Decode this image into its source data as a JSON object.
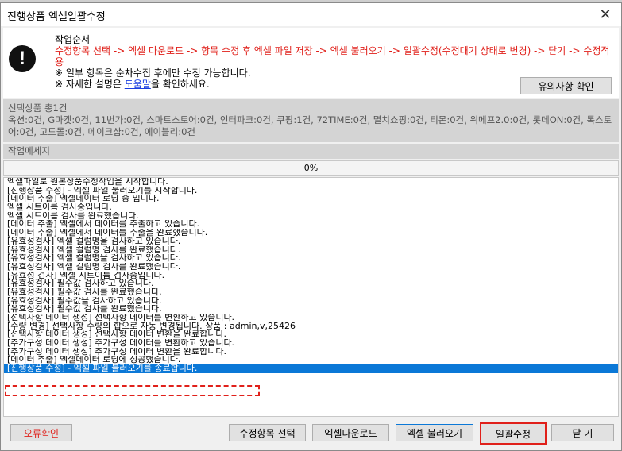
{
  "window": {
    "title": "진행상품 엑셀일괄수정",
    "close_label": "✕"
  },
  "instructions": {
    "heading": "작업순서",
    "steps": "수정항목 선택 -> 엑셀 다운로드 -> 항목 수정 후 엑셀 파일 저장 -> 엑셀 불러오기 -> 일괄수정(수정대기 상태로 변경) -> 닫기 -> 수정적용",
    "note1": "※ 일부 항목은 순차수집 후에만 수정 가능합니다.",
    "note2_prefix": "※ 자세한 설명은 ",
    "note2_link": "도움말",
    "note2_suffix": "을 확인하세요.",
    "caution_button": "유의사항 확인"
  },
  "summary": {
    "title": "선택상품 총1건",
    "detail": "옥션:0건, G마켓:0건, 11번가:0건, 스마트스토어:0건, 인터파크:0건, 쿠팡:1건, 72TIME:0건, 멸치쇼핑:0건, 티몬:0건, 위메프2.0:0건, 롯데ON:0건, 톡스토어:0건, 고도몰:0건, 메이크샵:0건, 에이블리:0건"
  },
  "messages": {
    "header": "작업메세지",
    "progress_text": "0%",
    "progress_value": 0,
    "lines": [
      "엑셀파일로 원본상품수정작업을 시작합니다.",
      "[진행상품 수정] - 엑셀 파일 불러오기를 시작합니다.",
      "[데이터 추출] 엑셀데이터 로딩 중 입니다.",
      "엑셀 시트이름 검사중입니다.",
      "엑셀 시트이름 검사를 완료했습니다.",
      "[데이터 추출] 엑셀에서 데이터를 추출하고 있습니다.",
      "[데이터 추출] 엑셀에서 데이터를 추출을 완료했습니다.",
      "[유효성검사] 엑셀 컬럼명을 검사하고 있습니다.",
      "[유효성검사] 엑셀 컬럼명 검사를 완료했습니다.",
      "[유효성검사] 엑셀 컬럼명을 검사하고 있습니다.",
      "[유효성검사] 엑셀 컬럼명 검사를 완료했습니다.",
      "[유효성 검사] 엑셀 시트이름 검사중입니다.",
      "[유효성검사] 필수값 검사하고 있습니다.",
      "[유효성검사] 필수값 검사를 완료했습니다.",
      "[유효성검사] 필수값을 검사하고 있습니다.",
      "[유효성검사] 필수값 검사를 완료했습니다.",
      "[선택사항 데이터 생성] 선택사항 데이터를 변환하고 있습니다.",
      "[수량 변경] 선택사항 수량의 합으로 자동 변경됩니다. 상품 : admin,v,25426",
      "[선택사항 데이터 생성] 선택사항 데이터 변환을 완료합니다.",
      "[추가구성 데이터 생성] 추가구성 데이터를 변환하고 있습니다.",
      "[추가구성 데이터 생성] 추가구성 데이터 변환을 완료합니다.",
      "[데이터 추출] 엑셀데이터 로딩에 성공했습니다.",
      "[진행상품 수정] - 엑셀 파일 불러오기를 종료합니다."
    ]
  },
  "buttons": {
    "error_check": "오류확인",
    "select_items": "수정항목 선택",
    "excel_download": "엑셀다운로드",
    "excel_load": "엑셀 불러오기",
    "bulk_edit": "일괄수정",
    "close": "닫 기"
  },
  "colors": {
    "accent_red": "#e0201a",
    "selection_blue": "#0b78d7",
    "link_blue": "#1a3ee0"
  }
}
